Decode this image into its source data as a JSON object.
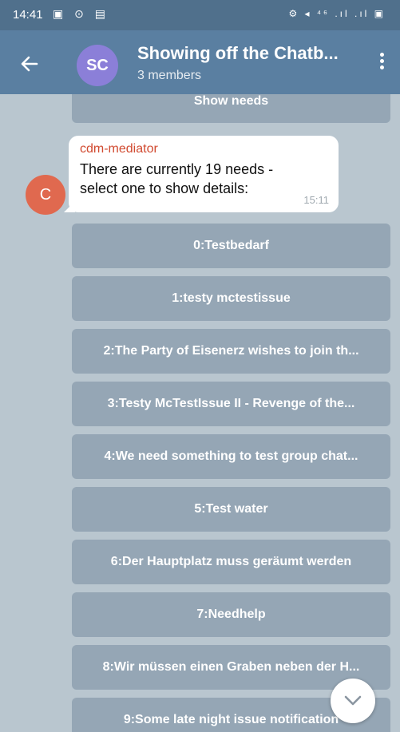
{
  "status_bar": {
    "time": "14:41",
    "left_icons": "▣ ⊙ ▤",
    "right_icons": "⚙ ◂ ⁴⁶ .ıl .ıl ▣"
  },
  "header": {
    "avatar_initials": "SC",
    "title": "Showing off the Chatb...",
    "subtitle": "3 members",
    "back_icon": "arrow-left",
    "menu_icon": "vertical-dots"
  },
  "chat": {
    "previous_button": "Show needs",
    "message": {
      "sender": "cdm-mediator",
      "sender_initial": "C",
      "text": "There are currently 19 needs - select one to show details:",
      "time": "15:11"
    },
    "buttons": [
      "0:Testbedarf",
      "1:testy mctestissue",
      "2:The Party of Eisenerz wishes to join th...",
      "3:Testy McTestIssue II - Revenge of the...",
      "4:We need something to test group chat...",
      "5:Test water",
      "6:Der Hauptplatz muss geräumt werden",
      "7:Needhelp",
      "8:Wir müssen einen Graben neben der H...",
      "9:Some late night issue notification"
    ]
  },
  "colors": {
    "header_bg": "#5a7fa1",
    "status_bg": "#50708c",
    "chat_bg": "#b9c6cf",
    "button_bg": "#95a6b5",
    "avatar_group": "#8b7fd8",
    "avatar_sender": "#e0694f",
    "sender_name": "#d14a30"
  }
}
